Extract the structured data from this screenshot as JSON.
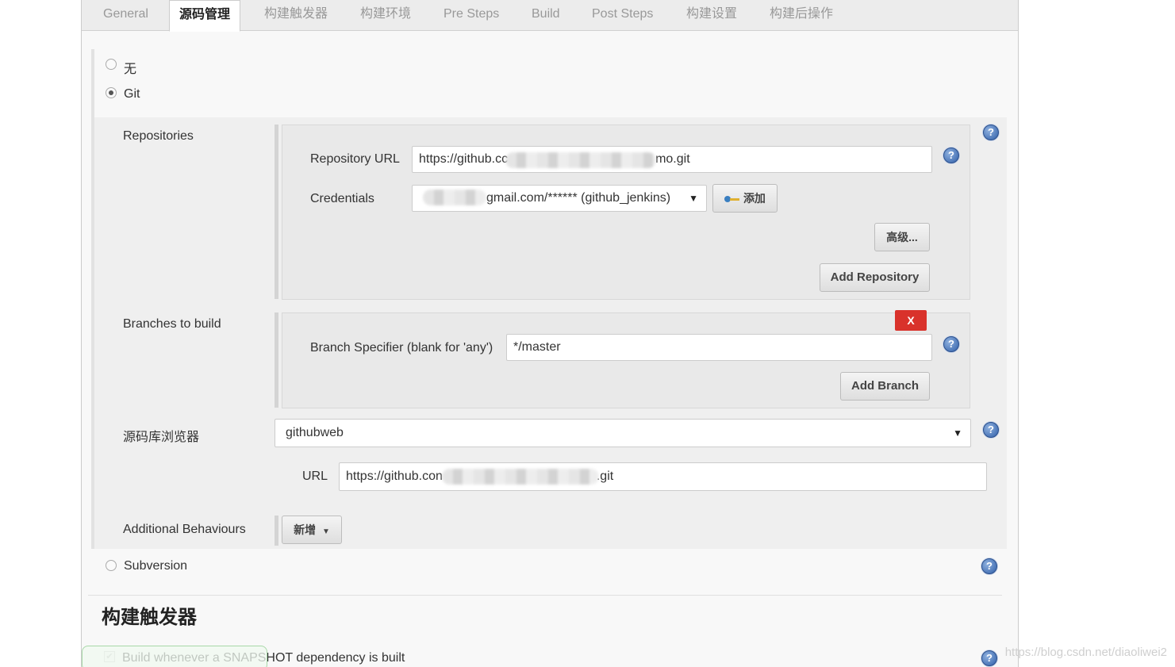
{
  "tabs": [
    {
      "label": "General",
      "active": false
    },
    {
      "label": "源码管理",
      "active": true
    },
    {
      "label": "构建触发器",
      "active": false
    },
    {
      "label": "构建环境",
      "active": false
    },
    {
      "label": "Pre Steps",
      "active": false
    },
    {
      "label": "Build",
      "active": false
    },
    {
      "label": "Post Steps",
      "active": false
    },
    {
      "label": "构建设置",
      "active": false
    },
    {
      "label": "构建后操作",
      "active": false
    }
  ],
  "scm": {
    "option_none": "无",
    "option_git": "Git",
    "option_svn": "Subversion",
    "selected": "Git"
  },
  "repositories": {
    "label": "Repositories",
    "repo_url_label": "Repository URL",
    "repo_url_prefix": "https://github.cc",
    "repo_url_suffix": "mo.git",
    "credentials_label": "Credentials",
    "credentials_value": "gmail.com/****** (github_jenkins)",
    "add_button": "添加",
    "advanced_button": "高级...",
    "add_repository_button": "Add Repository"
  },
  "branches": {
    "label": "Branches to build",
    "delete_button": "X",
    "specifier_label": "Branch Specifier (blank for 'any')",
    "specifier_value": "*/master",
    "add_branch_button": "Add Branch"
  },
  "browser": {
    "label": "源码库浏览器",
    "selected": "githubweb",
    "url_label": "URL",
    "url_prefix": "https://github.con",
    "url_suffix": ".git"
  },
  "additional": {
    "label": "Additional Behaviours",
    "add_button": "新增"
  },
  "triggers": {
    "heading": "构建触发器",
    "snapshot_checkbox": "Build whenever a SNAPSHOT dependency is built",
    "snapshot_checked": true
  },
  "watermark": "https://blog.csdn.net/diaoliwei2",
  "colors": {
    "delete_red": "#d9322b",
    "help_blue": "#2f5ea8"
  }
}
